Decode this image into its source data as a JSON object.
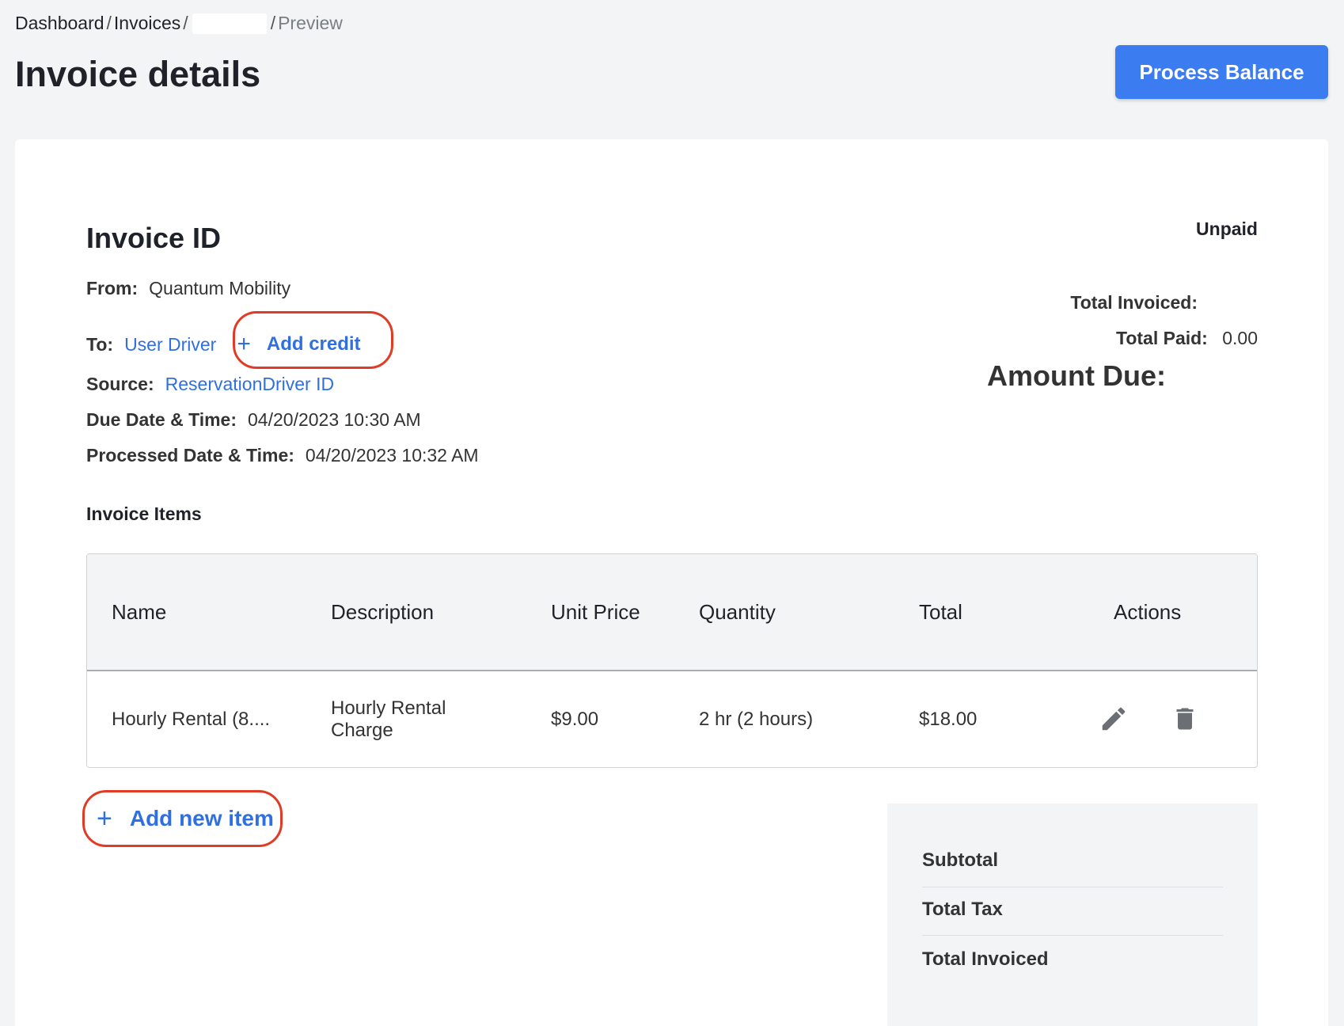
{
  "breadcrumb": {
    "items": [
      "Dashboard",
      "Invoices",
      ""
    ],
    "separator": "/",
    "current": "Preview"
  },
  "page": {
    "title": "Invoice details",
    "process_button": "Process Balance"
  },
  "invoice": {
    "heading": "Invoice ID",
    "status": "Unpaid",
    "from_label": "From:",
    "from_value": "Quantum Mobility",
    "to_label": "To:",
    "to_value": "User Driver",
    "add_credit": "Add credit",
    "source_label": "Source:",
    "source_value": "ReservationDriver ID",
    "due_label": "Due Date & Time:",
    "due_value": "04/20/2023 10:30 AM",
    "processed_label": "Processed Date & Time:",
    "processed_value": "04/20/2023 10:32 AM"
  },
  "totals": {
    "total_invoiced_label": "Total Invoiced:",
    "total_paid_label": "Total Paid:",
    "total_paid_value": "0.00",
    "amount_due_label": "Amount Due:"
  },
  "items": {
    "heading": "Invoice Items",
    "columns": [
      "Name",
      "Description",
      "Unit Price",
      "Quantity",
      "Total",
      "Actions"
    ],
    "rows": [
      {
        "name": "Hourly Rental (8....",
        "description_line1": "Hourly Rental",
        "description_line2": "Charge",
        "unit_price": "$9.00",
        "quantity": "2 hr (2 hours)",
        "total": "$18.00"
      }
    ],
    "add_new_item": "Add new item"
  },
  "summary": {
    "subtotal": "Subtotal",
    "total_tax": "Total Tax",
    "total_invoiced": "Total Invoiced"
  },
  "icons": {
    "add": "plus-icon",
    "edit": "pencil-icon",
    "delete": "trash-icon"
  },
  "colors": {
    "accent": "#3b7cf0",
    "link": "#2f6fe0",
    "highlight_ring": "#e03b24",
    "background": "#f3f4f6"
  }
}
